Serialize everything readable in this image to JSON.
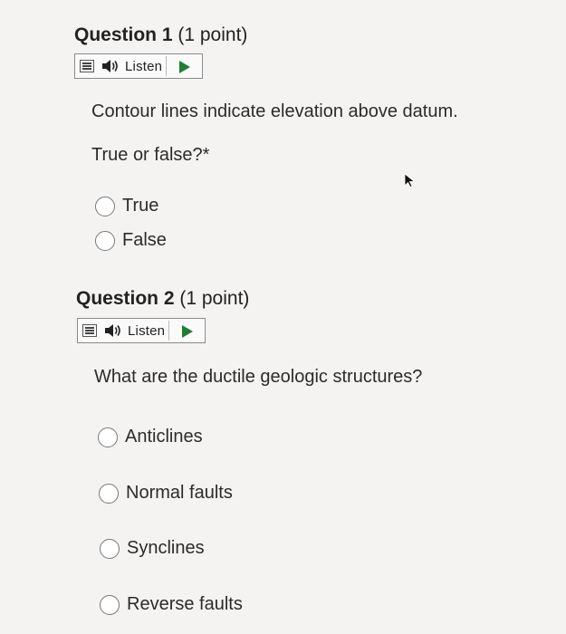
{
  "questions": [
    {
      "title": "Question 1",
      "points": "(1 point)",
      "listen_label": "Listen",
      "prompt_lines": [
        "Contour lines indicate elevation above datum.",
        "True or false?*"
      ],
      "options": [
        "True",
        "False"
      ]
    },
    {
      "title": "Question 2",
      "points": "(1 point)",
      "listen_label": "Listen",
      "prompt_lines": [
        "What are the ductile geologic structures?"
      ],
      "options": [
        "Anticlines",
        "Normal faults",
        "Synclines",
        "Reverse faults"
      ]
    }
  ],
  "icons": {
    "menu": "menu-icon",
    "speaker": "speaker-icon",
    "play": "play-icon",
    "cursor": "mouse-pointer-icon"
  },
  "colors": {
    "play_green": "#1e7e34",
    "background": "#f4f3f1"
  }
}
